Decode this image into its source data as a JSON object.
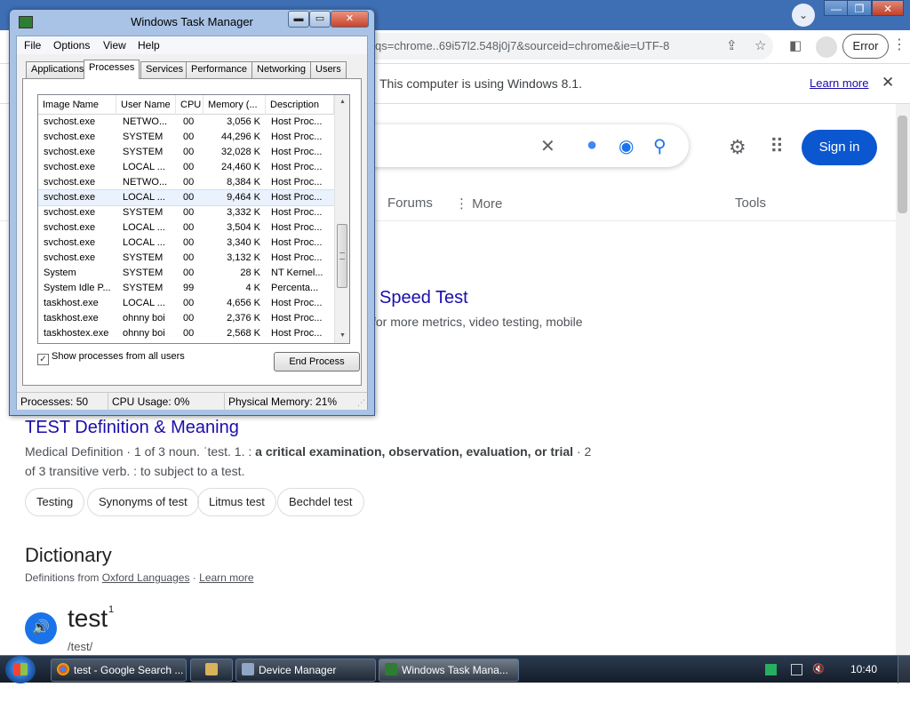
{
  "chrome": {
    "url": "qs=chrome..69i57l2.548j0j7&sourceid=chrome&ie=UTF-8",
    "error_label": "Error",
    "infobar_text": "This computer is using Windows 8.1.",
    "infobar_link": "Learn more",
    "signin_label": "Sign in",
    "nav": {
      "forums": "Forums",
      "more": "More",
      "tools": "Tools"
    }
  },
  "results": {
    "speedtest_title": "Speed Test",
    "speedtest_snippet": "for more metrics, video testing, mobile",
    "def_title": "TEST Definition & Meaning",
    "def_line1_pre": "Medical Definition · 1 of 3 noun. ˈtest. 1. : ",
    "def_line1_bold": "a critical examination, observation, evaluation, or trial",
    "def_line1_post": " · 2",
    "def_line2": "of 3 transitive verb. : to subject to a test.",
    "chips": [
      "Testing",
      "Synonyms of test",
      "Litmus test",
      "Bechdel test"
    ],
    "dictionary_title": "Dictionary",
    "definitions_from": "Definitions from",
    "oxford": "Oxford Languages",
    "learn_more": "Learn more",
    "word": "test",
    "word_sup": "1",
    "pronunciation": "/test/"
  },
  "taskmgr": {
    "title": "Windows Task Manager",
    "menus": [
      "File",
      "Options",
      "View",
      "Help"
    ],
    "tabs": [
      "Applications",
      "Processes",
      "Services",
      "Performance",
      "Networking",
      "Users"
    ],
    "active_tab": "Processes",
    "columns": [
      "Image Name",
      "User Name",
      "CPU",
      "Memory (...",
      "Description"
    ],
    "rows": [
      [
        "svchost.exe",
        "NETWO...",
        "00",
        "3,056 K",
        "Host Proc..."
      ],
      [
        "svchost.exe",
        "SYSTEM",
        "00",
        "44,296 K",
        "Host Proc..."
      ],
      [
        "svchost.exe",
        "SYSTEM",
        "00",
        "32,028 K",
        "Host Proc..."
      ],
      [
        "svchost.exe",
        "LOCAL ...",
        "00",
        "24,460 K",
        "Host Proc..."
      ],
      [
        "svchost.exe",
        "NETWO...",
        "00",
        "8,384 K",
        "Host Proc..."
      ],
      [
        "svchost.exe",
        "LOCAL ...",
        "00",
        "9,464 K",
        "Host Proc..."
      ],
      [
        "svchost.exe",
        "SYSTEM",
        "00",
        "3,332 K",
        "Host Proc..."
      ],
      [
        "svchost.exe",
        "LOCAL ...",
        "00",
        "3,504 K",
        "Host Proc..."
      ],
      [
        "svchost.exe",
        "LOCAL ...",
        "00",
        "3,340 K",
        "Host Proc..."
      ],
      [
        "svchost.exe",
        "SYSTEM",
        "00",
        "3,132 K",
        "Host Proc..."
      ],
      [
        "System",
        "SYSTEM",
        "00",
        "28 K",
        "NT Kernel..."
      ],
      [
        "System Idle P...",
        "SYSTEM",
        "99",
        "4 K",
        "Percenta..."
      ],
      [
        "taskhost.exe",
        "LOCAL ...",
        "00",
        "4,656 K",
        "Host Proc..."
      ],
      [
        "taskhost.exe",
        "ohnny boi",
        "00",
        "2,376 K",
        "Host Proc..."
      ],
      [
        "taskhostex.exe",
        "ohnny boi",
        "00",
        "2,568 K",
        "Host Proc..."
      ]
    ],
    "selected_row": 5,
    "show_all_label": "Show processes from all users",
    "show_all_checked": true,
    "end_process_label": "End Process",
    "status": {
      "processes": "Processes: 50",
      "cpu": "CPU Usage: 0%",
      "memory": "Physical Memory: 21%"
    }
  },
  "taskbar": {
    "buttons": [
      {
        "label": "test - Google Search ...",
        "icon": "chrome-icon"
      },
      {
        "label": "",
        "icon": "folder-icon"
      },
      {
        "label": "Device Manager",
        "icon": "device-manager-icon"
      },
      {
        "label": "Windows Task Mana...",
        "icon": "task-manager-icon"
      }
    ],
    "clock": "10:40 PM"
  },
  "colors": {
    "accent_blue": "#0b57d0",
    "link_blue": "#1a0dab",
    "taskbar": "#1b2636",
    "window_frame": "#a9c3e6"
  }
}
